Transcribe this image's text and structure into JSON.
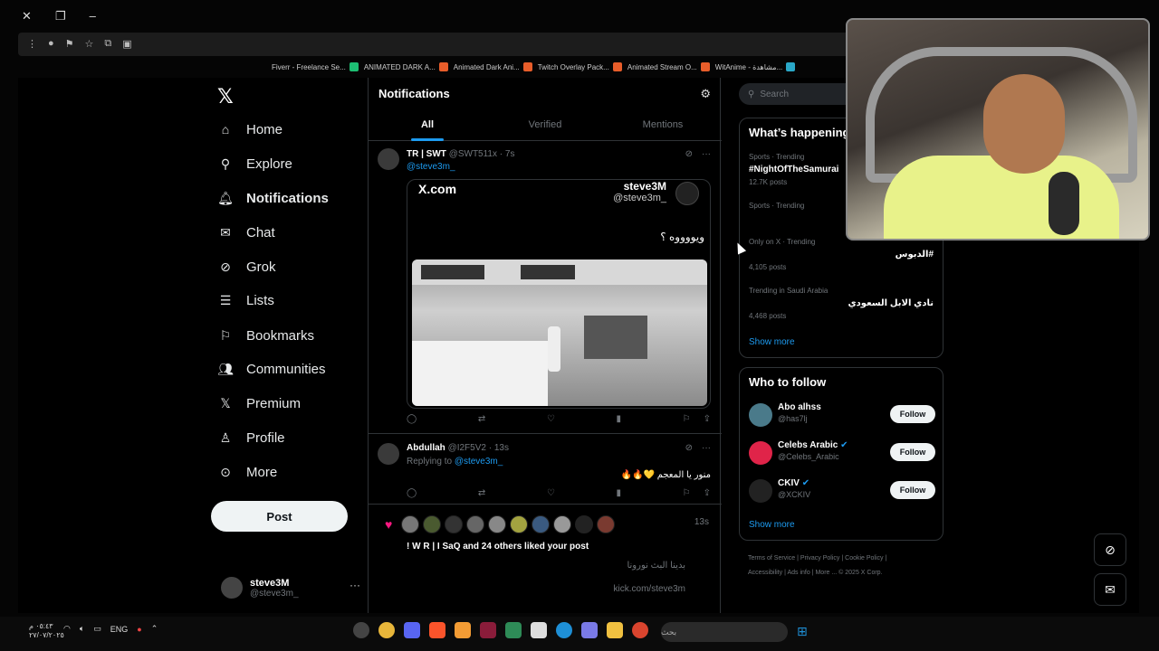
{
  "browser": {
    "bookmarks": [
      {
        "label": "Fiverr - Freelance Se...",
        "color": "#1dbf73"
      },
      {
        "label": "ANIMATED DARK A...",
        "color": "#e85d2a"
      },
      {
        "label": "Animated Dark Ani...",
        "color": "#e85d2a"
      },
      {
        "label": "Twitch Overlay Pack...",
        "color": "#e85d2a"
      },
      {
        "label": "Animated Stream O...",
        "color": "#e85d2a"
      },
      {
        "label": "WitAnime - مشاهدة...",
        "color": "#2aa8c8"
      }
    ]
  },
  "sidebar": {
    "items": [
      {
        "label": "Home",
        "icon": "home-icon"
      },
      {
        "label": "Explore",
        "icon": "search-icon"
      },
      {
        "label": "Notifications",
        "icon": "bell-icon"
      },
      {
        "label": "Chat",
        "icon": "mail-icon"
      },
      {
        "label": "Grok",
        "icon": "grok-icon"
      },
      {
        "label": "Lists",
        "icon": "list-icon"
      },
      {
        "label": "Bookmarks",
        "icon": "bookmark-icon"
      },
      {
        "label": "Communities",
        "icon": "people-icon"
      },
      {
        "label": "Premium",
        "icon": "x-icon"
      },
      {
        "label": "Profile",
        "icon": "person-icon"
      },
      {
        "label": "More",
        "icon": "more-circle-icon"
      }
    ],
    "post_label": "Post",
    "account": {
      "name": "steve3M",
      "handle": "@steve3m_"
    }
  },
  "main": {
    "title": "Notifications",
    "tabs": [
      "All",
      "Verified",
      "Mentions"
    ],
    "tweets": [
      {
        "name": "TR | SWT",
        "handle": "@SWT511x",
        "time": "· 7s",
        "reply_to": "@steve3m_",
        "card": {
          "site": "X.com",
          "name": "steve3M",
          "handle": "@steve3m_",
          "text": "ويووووه ؟"
        }
      },
      {
        "name": "Abdullah",
        "handle": "@I2F5V2",
        "time": "· 13s",
        "replying_prefix": "Replying to",
        "reply_to": "@steve3m_",
        "text": "منور يا المعجم 💛🔥🔥"
      }
    ],
    "like_notification": {
      "time": "13s",
      "text": "! W R | I SaQ and 24 others liked your post",
      "quote_line1": "بدينا البث نورونا",
      "quote_line2": "kick.com/steve3m"
    }
  },
  "right": {
    "search_placeholder": "Search",
    "trends_title": "What’s happening",
    "trends": [
      {
        "meta": "Sports · Trending",
        "name": "#NightOfTheSamurai",
        "posts": "12.7K posts"
      },
      {
        "meta": "Sports · Trending",
        "name": "",
        "posts": ""
      },
      {
        "meta": "Only on X · Trending",
        "name": "#الدبوس",
        "posts": "4,105 posts"
      },
      {
        "meta": "Trending in Saudi Arabia",
        "name": "نادي الابل السعودي",
        "posts": "4,468 posts"
      }
    ],
    "show_more": "Show more",
    "follow_title": "Who to follow",
    "follow": [
      {
        "name": "Abo alhss",
        "handle": "@has7lj",
        "verified": false
      },
      {
        "name": "Celebs Arabic",
        "handle": "@Celebs_Arabic",
        "verified": true
      },
      {
        "name": "CKIV",
        "handle": "@XCKIV",
        "verified": true
      }
    ],
    "follow_label": "Follow",
    "footer": [
      "Terms of Service",
      "Privacy Policy",
      "Cookie Policy",
      "Accessibility",
      "Ads info",
      "More ...",
      "© 2025 X Corp."
    ]
  },
  "taskbar": {
    "time": "٠٥:٤٣ م",
    "date": "٢٧/٠٧/٢٠٢٥",
    "lang": "ENG",
    "search_placeholder": "بحث"
  },
  "colors": {
    "accent": "#1d9bf0",
    "like": "#f91880",
    "bg": "#000000"
  }
}
